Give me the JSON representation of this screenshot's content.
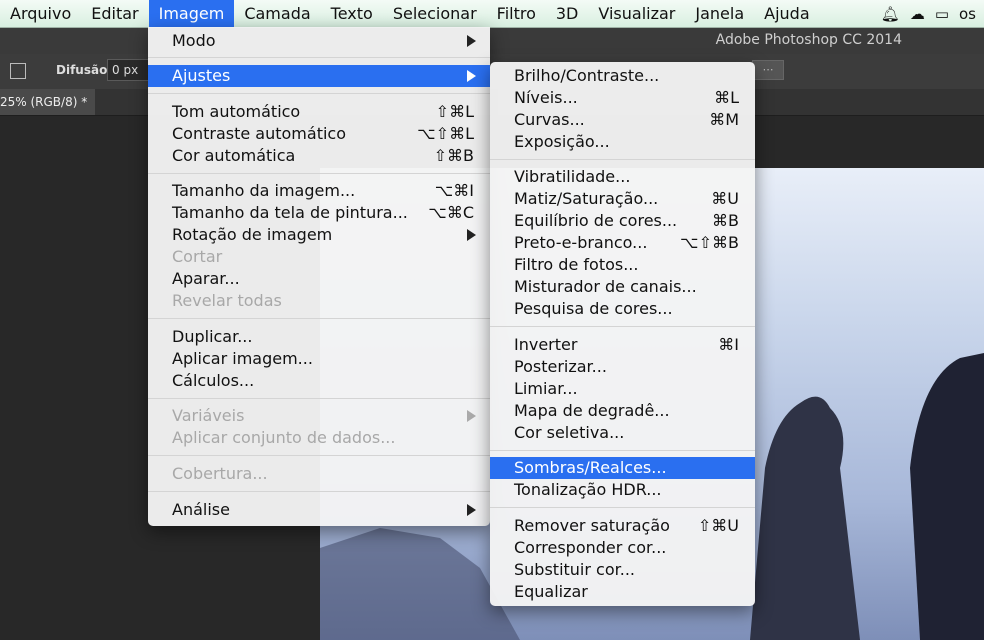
{
  "menubar": {
    "items": [
      "Arquivo",
      "Editar",
      "Imagem",
      "Camada",
      "Texto",
      "Selecionar",
      "Filtro",
      "3D",
      "Visualizar",
      "Janela",
      "Ajuda"
    ],
    "active": "Imagem",
    "status_text": "os"
  },
  "app": {
    "title": "Adobe Photoshop CC 2014",
    "options": {
      "difusao_label": "Difusão:",
      "difusao_value": "0 px"
    },
    "doc_tab": "25% (RGB/8) *"
  },
  "imagem_menu": {
    "modo": "Modo",
    "ajustes": "Ajustes",
    "tom_auto": "Tom automático",
    "tom_auto_sc": "⇧⌘L",
    "contraste_auto": "Contraste automático",
    "contraste_auto_sc": "⌥⇧⌘L",
    "cor_auto": "Cor automática",
    "cor_auto_sc": "⇧⌘B",
    "tamanho_imagem": "Tamanho da imagem...",
    "tamanho_imagem_sc": "⌥⌘I",
    "tamanho_tela": "Tamanho da tela de pintura...",
    "tamanho_tela_sc": "⌥⌘C",
    "rotacao": "Rotação de imagem",
    "cortar": "Cortar",
    "aparar": "Aparar...",
    "revelar": "Revelar todas",
    "duplicar": "Duplicar...",
    "aplicar_imagem": "Aplicar imagem...",
    "calculos": "Cálculos...",
    "variaveis": "Variáveis",
    "aplicar_conjunto": "Aplicar conjunto de dados...",
    "cobertura": "Cobertura...",
    "analise": "Análise"
  },
  "ajustes_menu": {
    "brilho": "Brilho/Contraste...",
    "niveis": "Níveis...",
    "niveis_sc": "⌘L",
    "curvas": "Curvas...",
    "curvas_sc": "⌘M",
    "exposicao": "Exposição...",
    "vibratilidade": "Vibratilidade...",
    "matiz": "Matiz/Saturação...",
    "matiz_sc": "⌘U",
    "equilibrio": "Equilíbrio de cores...",
    "equilibrio_sc": "⌘B",
    "preto_branco": "Preto-e-branco...",
    "preto_branco_sc": "⌥⇧⌘B",
    "filtro_fotos": "Filtro de fotos...",
    "misturador": "Misturador de canais...",
    "pesquisa": "Pesquisa de cores...",
    "inverter": "Inverter",
    "inverter_sc": "⌘I",
    "posterizar": "Posterizar...",
    "limiar": "Limiar...",
    "mapa": "Mapa de degradê...",
    "cor_seletiva": "Cor seletiva...",
    "sombras": "Sombras/Realces...",
    "tonalizacao": "Tonalização HDR...",
    "remover": "Remover saturação",
    "remover_sc": "⇧⌘U",
    "corresponder": "Corresponder cor...",
    "substituir": "Substituir cor...",
    "equalizar": "Equalizar"
  }
}
